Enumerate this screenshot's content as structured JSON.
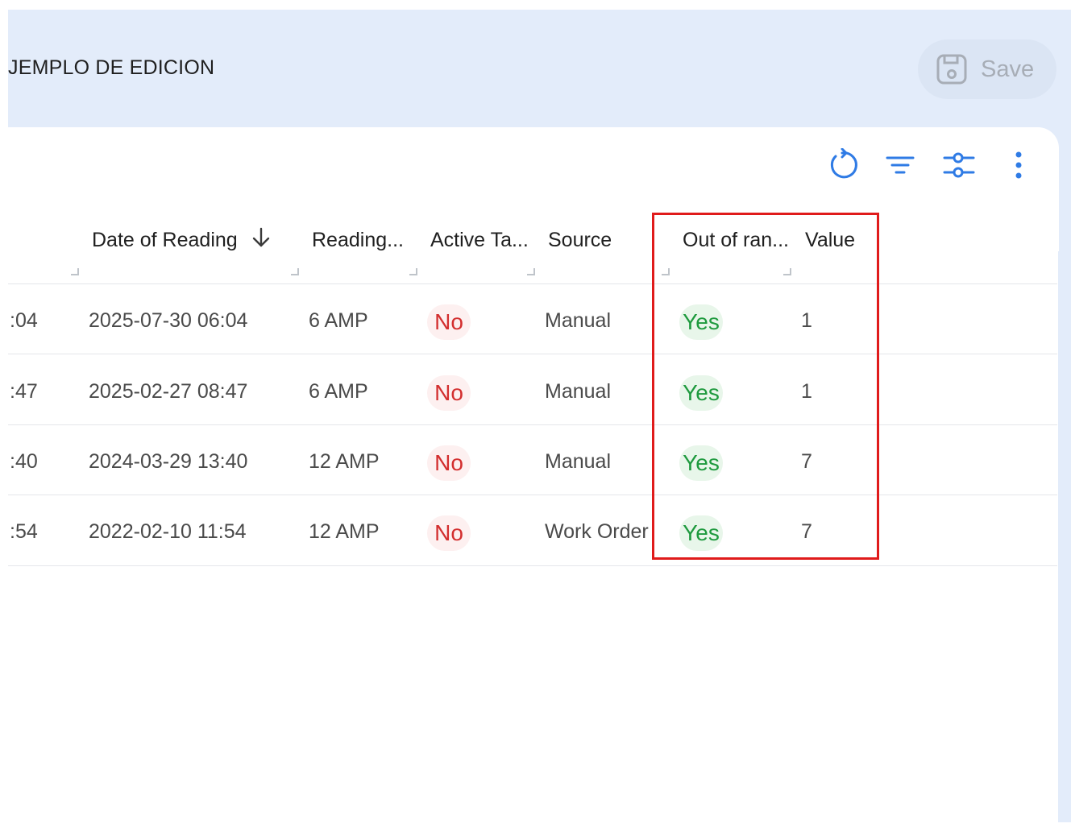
{
  "header": {
    "title": "JEMPLO DE EDICION",
    "save_label": "Save"
  },
  "toolbar": {
    "icons": [
      "refresh-icon",
      "filter-icon",
      "tune-icon",
      "more-vert-icon"
    ],
    "accent_color": "#2f7be5"
  },
  "table": {
    "columns": [
      {
        "label": "Date of Reading",
        "sorted": "descending"
      },
      {
        "label": "Reading..."
      },
      {
        "label": "Active Ta..."
      },
      {
        "label": "Source"
      },
      {
        "label": "Out of ran..."
      },
      {
        "label": "Value"
      }
    ],
    "rows": [
      {
        "time_tail": ":04",
        "date": "2025-07-30 06:04",
        "reading": "6 AMP",
        "active": "No",
        "source": "Manual",
        "out_of_range": "Yes",
        "value": "1"
      },
      {
        "time_tail": ":47",
        "date": "2025-02-27 08:47",
        "reading": "6 AMP",
        "active": "No",
        "source": "Manual",
        "out_of_range": "Yes",
        "value": "1"
      },
      {
        "time_tail": ":40",
        "date": "2024-03-29 13:40",
        "reading": "12 AMP",
        "active": "No",
        "source": "Manual",
        "out_of_range": "Yes",
        "value": "7"
      },
      {
        "time_tail": ":54",
        "date": "2022-02-10 11:54",
        "reading": "12 AMP",
        "active": "No",
        "source": "Work Order",
        "out_of_range": "Yes",
        "value": "7"
      }
    ]
  },
  "colors": {
    "header_bg": "#e3ecfa",
    "no_badge": "#d32f2f",
    "yes_badge": "#1e9a3e",
    "highlight": "#e01b1b"
  }
}
